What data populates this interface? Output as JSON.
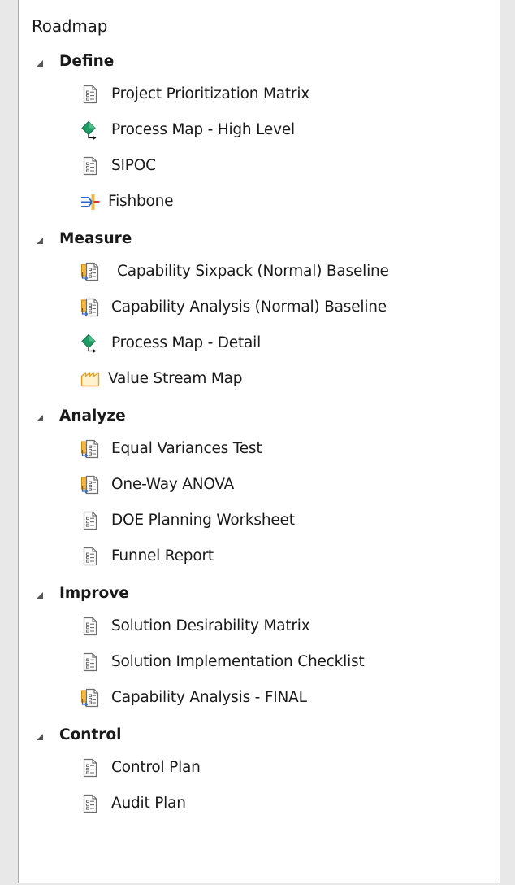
{
  "panel": {
    "title": "Roadmap",
    "phases": [
      {
        "label": "Define",
        "items": [
          {
            "label": "Project Prioritization Matrix",
            "icon": "form-document-icon"
          },
          {
            "label": "Process Map - High Level",
            "icon": "process-map-icon"
          },
          {
            "label": "SIPOC",
            "icon": "form-document-icon"
          },
          {
            "label": "Fishbone",
            "icon": "fishbone-icon"
          }
        ]
      },
      {
        "label": "Measure",
        "items": [
          {
            "label": "Capability Sixpack (Normal) Baseline",
            "icon": "analysis-document-icon"
          },
          {
            "label": "Capability Analysis (Normal) Baseline",
            "icon": "analysis-document-icon"
          },
          {
            "label": "Process Map - Detail",
            "icon": "process-map-icon"
          },
          {
            "label": "Value Stream Map",
            "icon": "value-stream-map-icon"
          }
        ]
      },
      {
        "label": "Analyze",
        "items": [
          {
            "label": "Equal Variances Test",
            "icon": "analysis-document-icon"
          },
          {
            "label": "One-Way ANOVA",
            "icon": "analysis-document-icon"
          },
          {
            "label": "DOE Planning Worksheet",
            "icon": "form-document-icon"
          },
          {
            "label": "Funnel Report",
            "icon": "form-document-icon"
          }
        ]
      },
      {
        "label": "Improve",
        "items": [
          {
            "label": "Solution Desirability Matrix",
            "icon": "form-document-icon"
          },
          {
            "label": "Solution Implementation Checklist",
            "icon": "form-document-icon"
          },
          {
            "label": "Capability Analysis - FINAL",
            "icon": "analysis-document-icon"
          }
        ]
      },
      {
        "label": "Control",
        "items": [
          {
            "label": "Control Plan",
            "icon": "form-document-icon"
          },
          {
            "label": "Audit Plan",
            "icon": "form-document-icon"
          }
        ]
      }
    ]
  },
  "colors": {
    "background": "#e8e8e8",
    "panel": "#ffffff",
    "border": "#a9a9a9",
    "text": "#1a1a1a",
    "analysis_icon": "#f6b73c",
    "process_icon": "#1e9c64",
    "fishbone_icon": "#2b66c8",
    "value_stream_icon": "#e8a020"
  }
}
